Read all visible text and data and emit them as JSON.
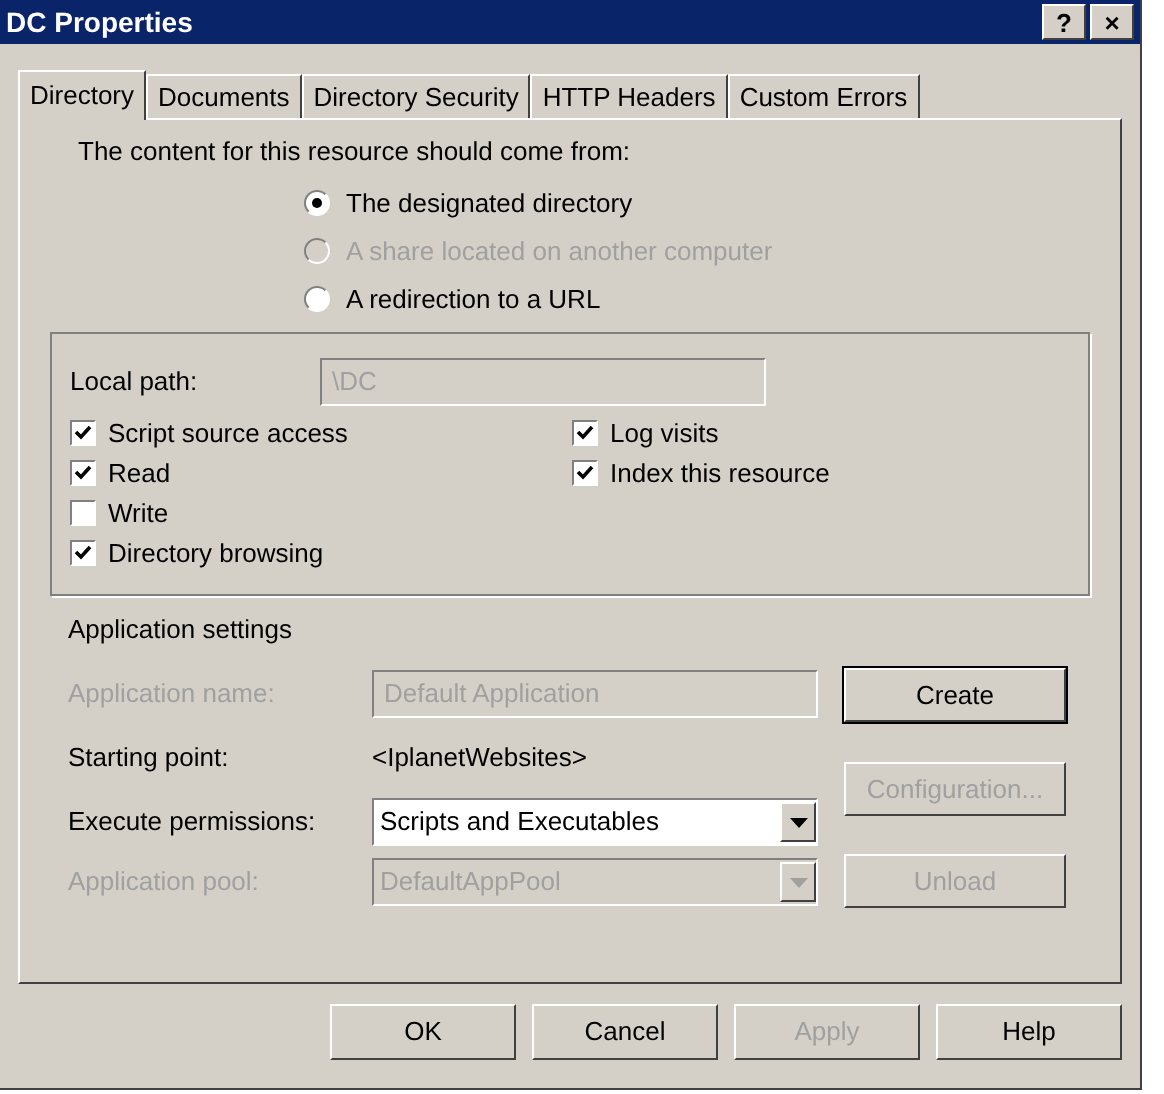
{
  "window": {
    "title": "DC Properties",
    "title_buttons": [
      "?",
      "×"
    ]
  },
  "tabs": [
    {
      "label": "Directory",
      "selected": true
    },
    {
      "label": "Documents",
      "selected": false
    },
    {
      "label": "Directory Security",
      "selected": false
    },
    {
      "label": "HTTP Headers",
      "selected": false
    },
    {
      "label": "Custom Errors",
      "selected": false
    }
  ],
  "source": {
    "prompt": "The content for this resource should come from:",
    "options": [
      {
        "label": "The designated directory",
        "selected": true,
        "disabled": false
      },
      {
        "label": "A share located on another computer",
        "selected": false,
        "disabled": true
      },
      {
        "label": "A redirection to a URL",
        "selected": false,
        "disabled": false
      }
    ]
  },
  "local_path": {
    "label": "Local path:",
    "value": "\\DC",
    "disabled": true
  },
  "checkboxes_left": [
    {
      "label": "Script source access",
      "checked": true
    },
    {
      "label": "Read",
      "checked": true
    },
    {
      "label": "Write",
      "checked": false
    },
    {
      "label": "Directory browsing",
      "checked": true
    }
  ],
  "checkboxes_right": [
    {
      "label": "Log visits",
      "checked": true
    },
    {
      "label": "Index this resource",
      "checked": true
    }
  ],
  "application_settings": {
    "heading": "Application settings",
    "application_name": {
      "label": "Application name:",
      "value": "Default Application",
      "disabled": true
    },
    "starting_point": {
      "label": "Starting point:",
      "value": "<IplanetWebsites>"
    },
    "execute_permissions": {
      "label": "Execute permissions:",
      "value": "Scripts and Executables",
      "disabled": false
    },
    "application_pool": {
      "label": "Application pool:",
      "value": "DefaultAppPool",
      "disabled": true
    },
    "buttons": [
      {
        "label": "Create",
        "disabled": false
      },
      {
        "label": "Configuration...",
        "disabled": true
      },
      {
        "label": "Unload",
        "disabled": true
      }
    ]
  },
  "buttons": [
    {
      "label": "OK",
      "disabled": false
    },
    {
      "label": "Cancel",
      "disabled": false
    },
    {
      "label": "Apply",
      "disabled": true
    },
    {
      "label": "Help",
      "disabled": false
    }
  ]
}
